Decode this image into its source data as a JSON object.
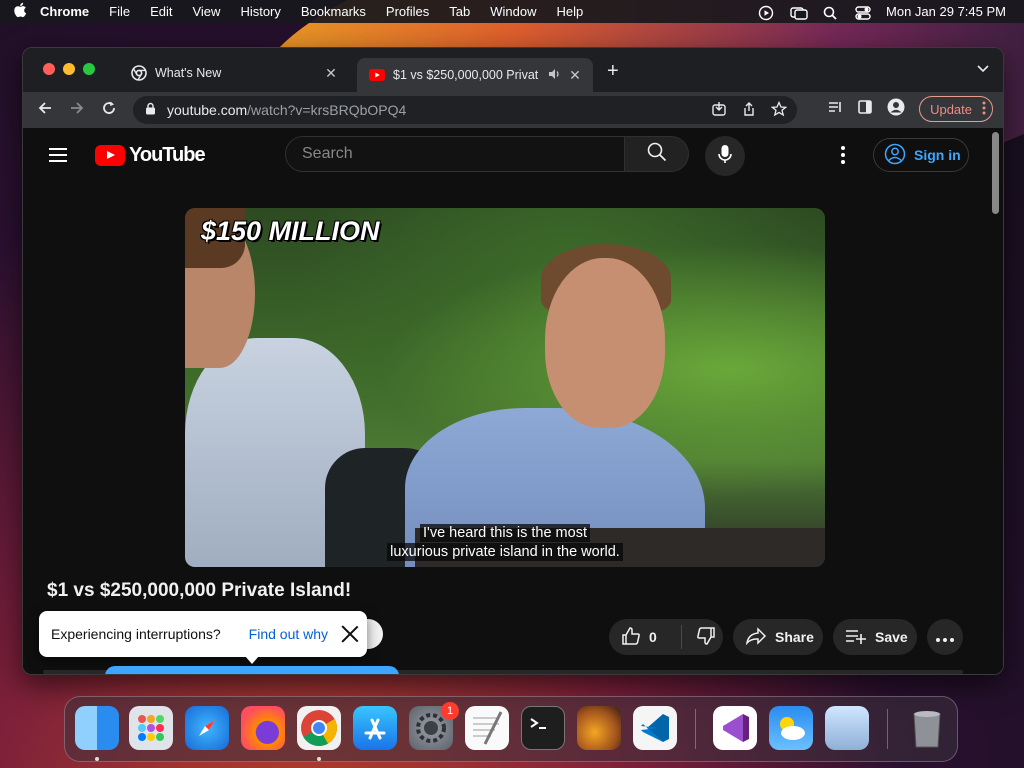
{
  "menubar": {
    "app": "Chrome",
    "items": [
      "File",
      "Edit",
      "View",
      "History",
      "Bookmarks",
      "Profiles",
      "Tab",
      "Window",
      "Help"
    ],
    "clock": "Mon Jan 29  7:45 PM"
  },
  "tabs": [
    {
      "title": "What's New"
    },
    {
      "title": "$1 vs $250,000,000 Privat"
    }
  ],
  "address": {
    "host": "youtube.com",
    "path": "/watch?v=krsBRQbOPQ4"
  },
  "toolbar": {
    "update_label": "Update"
  },
  "youtube": {
    "logo_text": "YouTube",
    "search_placeholder": "Search",
    "signin_label": "Sign in"
  },
  "video": {
    "overlay_text": "$150 MILLION",
    "caption_line1": "I've heard this is the most",
    "caption_line2": "luxurious private island in the world.",
    "title": "$1 vs $250,000,000 Private Island!"
  },
  "actions": {
    "like_count": "0",
    "share_label": "Share",
    "save_label": "Save"
  },
  "toast": {
    "message": "Experiencing interruptions?",
    "link": "Find out why"
  },
  "dock": {
    "apps": [
      "Finder",
      "Launchpad",
      "Safari",
      "Firefox",
      "Chrome",
      "App Store",
      "System Settings",
      "TextEdit",
      "Terminal",
      "GarageBand",
      "Visual Studio Code",
      "Visual Studio",
      "Weather",
      "Preview",
      "Trash"
    ],
    "settings_badge": "1"
  },
  "colors": {
    "accent_red": "#ff0000",
    "link_blue": "#3ea6ff",
    "update_red": "#f28b82"
  }
}
